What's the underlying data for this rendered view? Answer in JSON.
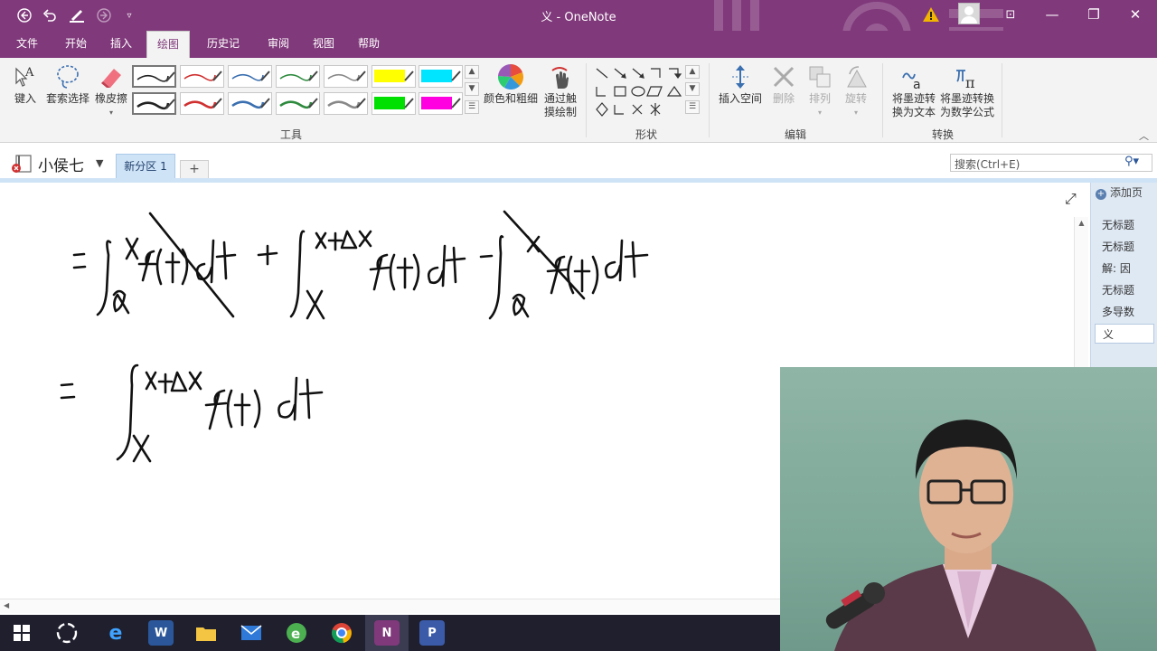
{
  "window": {
    "title": "义 - OneNote",
    "minimize": "—",
    "restore": "❐",
    "close": "✕"
  },
  "ribbon_tabs": [
    "文件",
    "开始",
    "插入",
    "绘图",
    "历史记录",
    "审阅",
    "视图",
    "帮助"
  ],
  "active_tab_index": 3,
  "ribbon": {
    "type_label": "键入",
    "lasso_label": "套索选择",
    "eraser_label": "橡皮擦",
    "color_thickness_label": "颜色和粗细",
    "touch_draw_label_1": "通过触",
    "touch_draw_label_2": "摸绘制",
    "insert_space_label": "插入空间",
    "delete_label": "删除",
    "arrange_label": "排列",
    "rotate_label": "旋转",
    "ink_to_text_1": "将墨迹转",
    "ink_to_text_2": "换为文本",
    "ink_to_math_1": "将墨迹转换",
    "ink_to_math_2": "为数学公式",
    "group_tools": "工具",
    "group_shapes": "形状",
    "group_edit": "编辑",
    "group_convert": "转换"
  },
  "pen_colors": {
    "row1": [
      "#222222",
      "#d03030",
      "#3a6fb0",
      "#2e8b3e",
      "#888888",
      "#ffff00",
      "#00e5ff"
    ],
    "row2": [
      "#222222",
      "#d03030",
      "#3a6fb0",
      "#2e8b3e",
      "#888888",
      "#00e000",
      "#ff00e0"
    ]
  },
  "notebook": {
    "name": "小侯七",
    "section": "新分区 1",
    "add_section": "+",
    "search_placeholder": "搜索(Ctrl+E)"
  },
  "pages": {
    "add_page": "添加页",
    "items": [
      "无标题",
      "无标题",
      "解: 因",
      "无标题",
      "多导数",
      "义"
    ],
    "active_index": 5
  },
  "icons": {
    "back": "back-icon",
    "undo": "undo-icon",
    "pen": "pen-icon",
    "redo": "redo-icon",
    "customize": "customize-icon",
    "search": "search-icon",
    "expand": "expand-icon"
  }
}
